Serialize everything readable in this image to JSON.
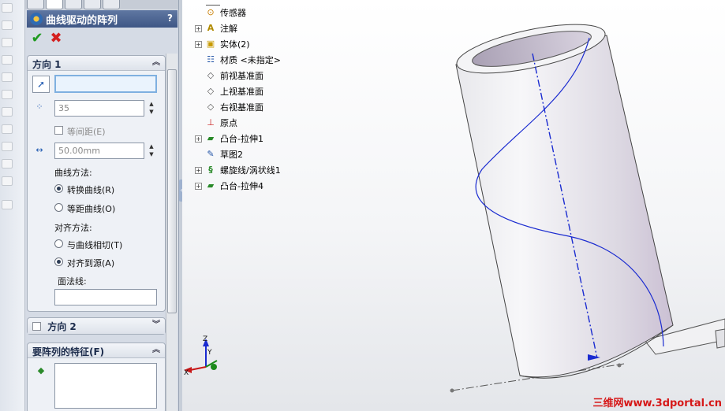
{
  "property_manager": {
    "title": "曲线驱动的阵列",
    "help": "?",
    "ok_symbol": "✔",
    "cancel_symbol": "✖",
    "direction1": {
      "title": "方向 1",
      "path_value": "",
      "instances_value": "35",
      "equal_spacing_label": "等间距(E)",
      "spacing_value": "50.00mm",
      "curve_method_label": "曲线方法:",
      "curve_methods": [
        "转换曲线(R)",
        "等距曲线(O)"
      ],
      "curve_method_selected": 0,
      "alignment_label": "对齐方法:",
      "alignments": [
        "与曲线相切(T)",
        "对齐到源(A)"
      ],
      "alignment_selected": 1,
      "face_label": "面法线:",
      "face_value": ""
    },
    "direction2": {
      "title": "方向 2"
    },
    "features": {
      "title": "要阵列的特征(F)"
    }
  },
  "tree": {
    "items": [
      {
        "label": "传感器",
        "icon": "sensor-icon",
        "expandable": false
      },
      {
        "label": "注解",
        "icon": "annotation-icon",
        "expandable": true
      },
      {
        "label": "实体(2)",
        "icon": "solid-bodies-icon",
        "expandable": true
      },
      {
        "label": "材质 <未指定>",
        "icon": "material-icon",
        "expandable": false
      },
      {
        "label": "前视基准面",
        "icon": "plane-icon",
        "expandable": false
      },
      {
        "label": "上视基准面",
        "icon": "plane-icon",
        "expandable": false
      },
      {
        "label": "右视基准面",
        "icon": "plane-icon",
        "expandable": false
      },
      {
        "label": "原点",
        "icon": "origin-icon",
        "expandable": false
      },
      {
        "label": "凸台-拉伸1",
        "icon": "extrude-icon",
        "expandable": true
      },
      {
        "label": "草图2",
        "icon": "sketch-icon",
        "expandable": false
      },
      {
        "label": "螺旋线/涡状线1",
        "icon": "helix-icon",
        "expandable": true
      },
      {
        "label": "凸台-拉伸4",
        "icon": "extrude-icon",
        "expandable": true
      }
    ]
  },
  "triad": {
    "x": "X",
    "y": "Y",
    "z": "Z"
  },
  "watermark": "三维网www.3dportal.cn",
  "colors": {
    "panel_header": "#3f5785",
    "helix": "#1a2bd0",
    "axis": "#1a2bd0",
    "watermark": "#d61818"
  }
}
